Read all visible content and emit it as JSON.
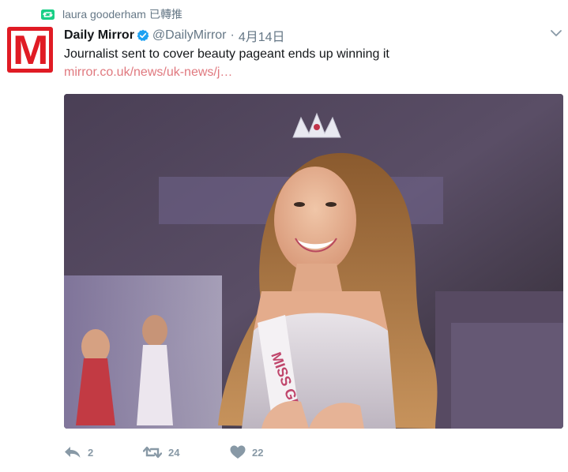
{
  "retweet_context": {
    "user": "laura gooderham",
    "verb": "已轉推",
    "icon": "retweet-icon",
    "color": "#19cf86"
  },
  "tweet": {
    "fullname": "Daily Mirror",
    "verified_icon": "verified-badge-icon",
    "username": "@DailyMirror",
    "separator": "·",
    "time": "4月14日",
    "text": "Journalist sent to cover beauty pageant ends up winning it",
    "link": "mirror.co.uk/news/uk-news/j…",
    "avatar_letter": "M",
    "avatar_color": "#e01b24"
  },
  "actions": {
    "reply": {
      "icon": "reply-icon",
      "count": "2"
    },
    "retweet": {
      "icon": "retweet-icon",
      "count": "24"
    },
    "like": {
      "icon": "heart-icon",
      "count": "22"
    },
    "icon_color": "#8899a6"
  },
  "menu": {
    "icon": "chevron-down-icon"
  }
}
